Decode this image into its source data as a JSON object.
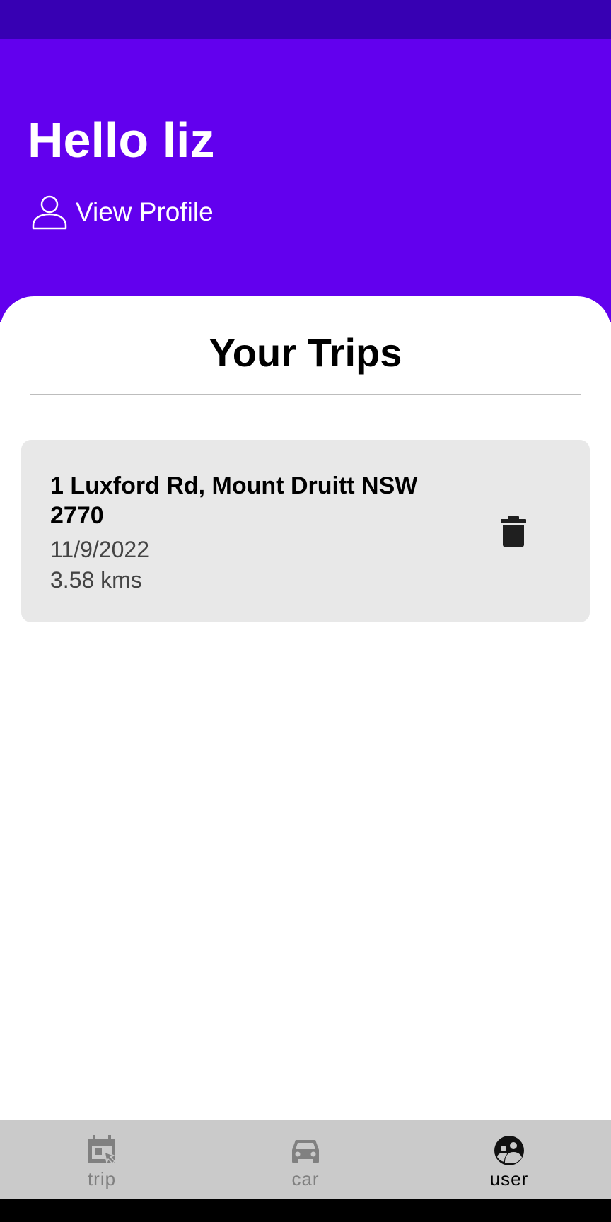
{
  "header": {
    "greeting": "Hello liz",
    "view_profile_label": "View Profile",
    "background_color": "#6200ee",
    "status_bar_color": "#3700b3"
  },
  "trips_section": {
    "title": "Your Trips",
    "trips": [
      {
        "address": "1 Luxford Rd, Mount Druitt NSW 2770",
        "date": "11/9/2022",
        "distance": "3.58 kms"
      }
    ]
  },
  "bottom_nav": {
    "items": [
      {
        "label": "trip",
        "icon": "calendar-click-icon",
        "active": false
      },
      {
        "label": "car",
        "icon": "car-icon",
        "active": false
      },
      {
        "label": "user",
        "icon": "user-group-icon",
        "active": true
      }
    ],
    "active_color": "#000000",
    "inactive_color": "#808080"
  }
}
